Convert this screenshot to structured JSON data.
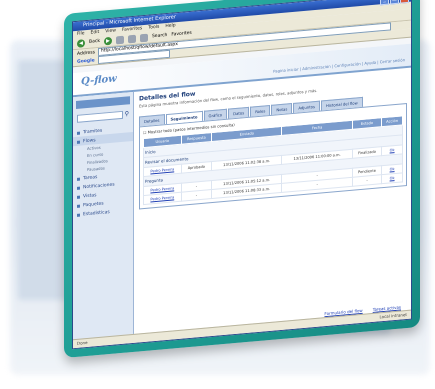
{
  "window": {
    "title": "Principal - Microsoft Internet Explorer",
    "menu": [
      "File",
      "Edit",
      "View",
      "Favorites",
      "Tools",
      "Help"
    ]
  },
  "toolbar": {
    "back_label": "Back",
    "search_label": "Search",
    "favorites_label": "Favorites"
  },
  "address": {
    "label": "Address",
    "value": "http://localhost/qflow/default.aspx"
  },
  "google": {
    "label": "Google"
  },
  "app": {
    "logo": "Q-flow",
    "toplinks": "Pagina iniciar | Administración | Configuración | Ayuda | Cerrar sesión"
  },
  "sidebar": {
    "items": [
      {
        "label": "Tramites",
        "sel": false
      },
      {
        "label": "Flows",
        "sel": true
      },
      {
        "label": "Tareas",
        "sel": false
      },
      {
        "label": "Notificaciones",
        "sel": false
      },
      {
        "label": "Vistas",
        "sel": false
      },
      {
        "label": "Paquetes",
        "sel": false
      },
      {
        "label": "Estadísticas",
        "sel": false
      }
    ],
    "subs": [
      "Activos",
      "En curso",
      "Finalizados",
      "Pausados"
    ]
  },
  "main": {
    "title": "Detalles del flow",
    "description": "Esta página muestra información del flow, como el seguimiento, datos, roles, adjuntos y más.",
    "tabs": [
      "Detalles",
      "Seguimiento",
      "Gráfico",
      "Datos",
      "Roles",
      "Notas",
      "Adjuntos",
      "Historial del flow"
    ],
    "active_tab": 1,
    "checkbox_label": "Mostrar todo (pasos intermedios sin consulta)",
    "columns": [
      "Usuario",
      "Respuesta",
      "Enviado",
      "Fecha",
      "Estado",
      "Acción"
    ],
    "steps": [
      {
        "name": "Inicio"
      },
      {
        "name": "Revisar el documento"
      },
      {
        "name": "Pregunta"
      }
    ],
    "rows": [
      {
        "user": "Pedro Pereira",
        "resp": "Aprobado",
        "sent": "13/11/2006 11:02:38 a.m.",
        "date": "13/11/2006 11:00:00 a.m.",
        "state": "Finalizado",
        "action": "Ok"
      },
      {
        "user": "Pedro Pereira",
        "resp": "-",
        "sent": "13/11/2006 11:05:12 a.m.",
        "date": "-",
        "state": "Pendiente",
        "action": "Ok"
      },
      {
        "user": "Pedro Pereira",
        "resp": "-",
        "sent": "13/11/2006 11:08:33 a.m.",
        "date": "-",
        "state": "-",
        "action": "Ok"
      }
    ],
    "footer_links": [
      "Formulario del flow",
      "Tareas activas"
    ]
  },
  "status": {
    "text": "Done",
    "zone": "Local intranet"
  }
}
